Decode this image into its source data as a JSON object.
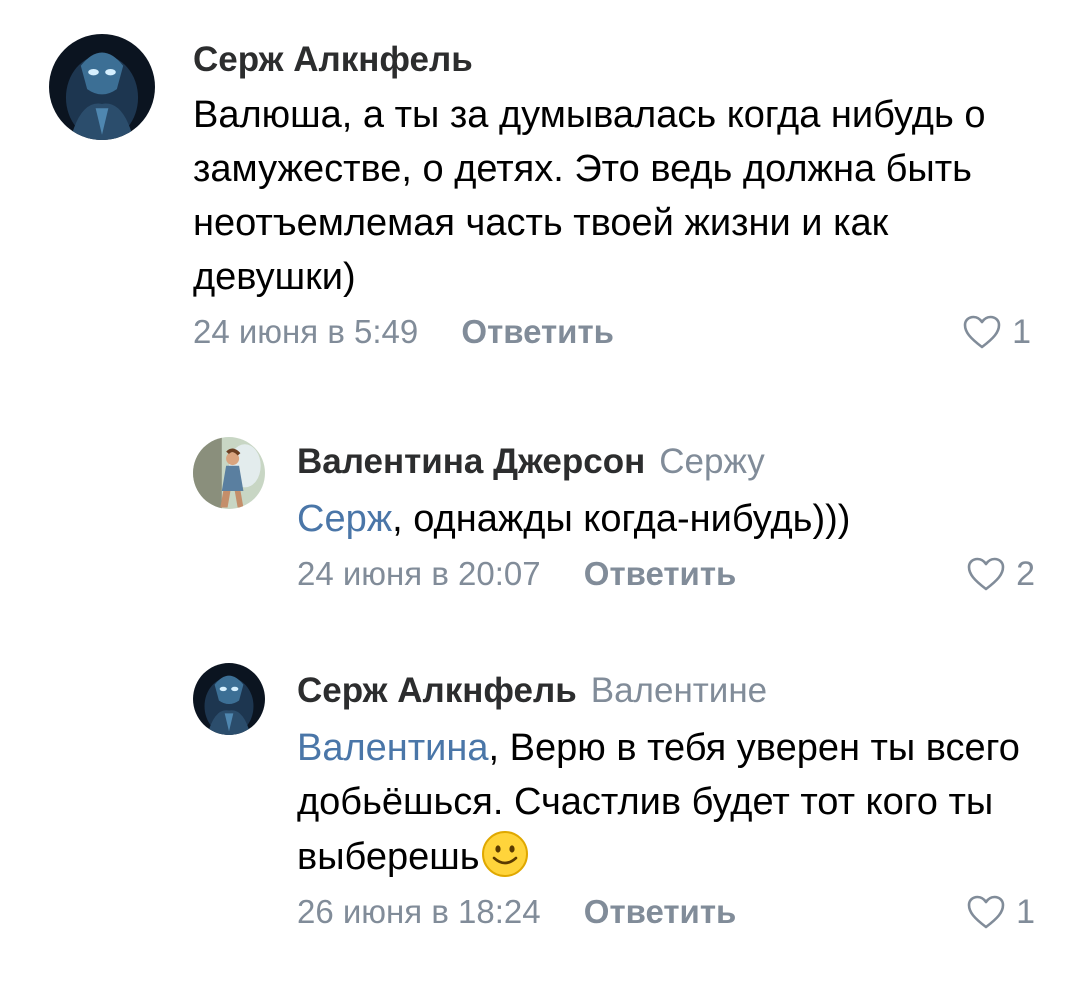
{
  "comments": [
    {
      "author": "Серж Алкнфель",
      "reply_to": "",
      "mention": "",
      "text": "Валюша, а ты за думывалась когда нибудь о замужестве, о детях. Это ведь должна быть неотъемлемая часть твоей жизни и как девушки)",
      "date": "24 июня в 5:49",
      "reply_label": "Ответить",
      "likes": "1",
      "avatar_icon": "alien-figure-avatar"
    },
    {
      "author": "Валентина Джерсон",
      "reply_to": "Сержу",
      "mention": "Серж",
      "text": ", однажды когда-нибудь)))",
      "date": "24 июня в 20:07",
      "reply_label": "Ответить",
      "likes": "2",
      "avatar_icon": "fairy-figure-avatar"
    },
    {
      "author": "Серж Алкнфель",
      "reply_to": "Валентине",
      "mention": "Валентина",
      "text": ", Верю в тебя уверен ты всего добьёшься. Счастлив будет тот кого ты выберешь",
      "emoji": "smile-emoji",
      "date": "26 июня в 18:24",
      "reply_label": "Ответить",
      "likes": "1",
      "avatar_icon": "alien-figure-avatar"
    }
  ],
  "colors": {
    "author": "#2c2d2e",
    "secondary": "#818c99",
    "mention": "#4a76a8"
  }
}
